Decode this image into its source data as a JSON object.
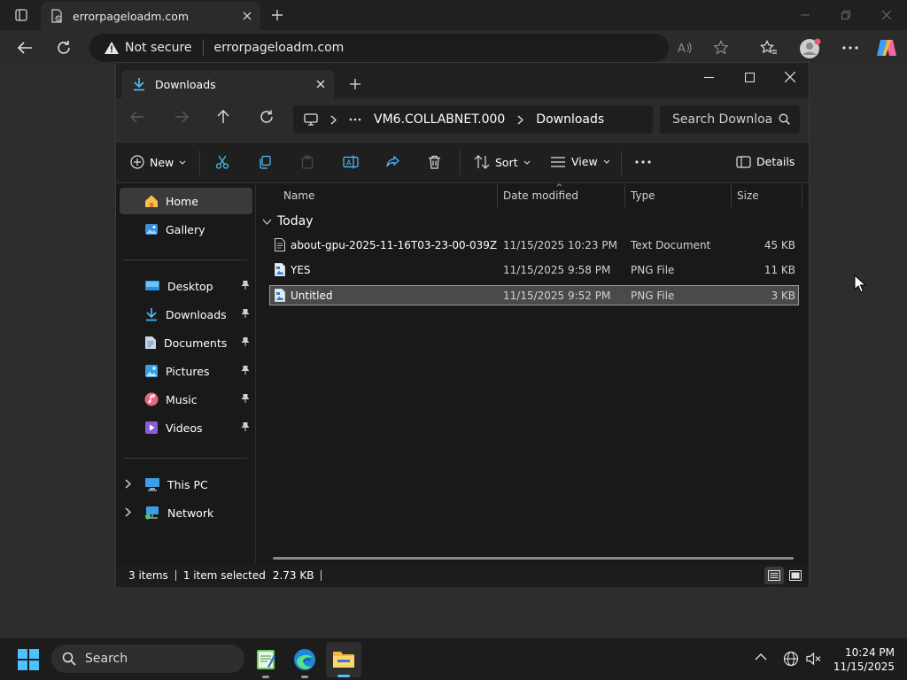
{
  "browser": {
    "tab_title": "errorpageloadm.com",
    "security_label": "Not secure",
    "url": "errorpageloadm.com"
  },
  "explorer": {
    "tab_title": "Downloads",
    "breadcrumb": [
      "VM6.COLLABNET.000",
      "Downloads"
    ],
    "search_placeholder": "Search Downloa",
    "commands": {
      "new": "New",
      "sort": "Sort",
      "view": "View",
      "details": "Details"
    },
    "sidebar": {
      "top": [
        {
          "label": "Home",
          "icon": "home-icon",
          "selected": true
        },
        {
          "label": "Gallery",
          "icon": "gallery-icon"
        }
      ],
      "pinned": [
        {
          "label": "Desktop",
          "icon": "desktop-icon"
        },
        {
          "label": "Downloads",
          "icon": "downloads-icon"
        },
        {
          "label": "Documents",
          "icon": "documents-icon"
        },
        {
          "label": "Pictures",
          "icon": "pictures-icon"
        },
        {
          "label": "Music",
          "icon": "music-icon"
        },
        {
          "label": "Videos",
          "icon": "videos-icon"
        }
      ],
      "bottom": [
        {
          "label": "This PC",
          "icon": "this-pc-icon"
        },
        {
          "label": "Network",
          "icon": "network-icon"
        }
      ]
    },
    "columns": [
      "Name",
      "Date modified",
      "Type",
      "Size"
    ],
    "group_label": "Today",
    "files": [
      {
        "name": "about-gpu-2025-11-16T03-23-00-039Z",
        "date": "11/15/2025 10:23 PM",
        "type": "Text Document",
        "size": "45 KB",
        "icon": "text-file-icon",
        "selected": false
      },
      {
        "name": "YES",
        "date": "11/15/2025 9:58 PM",
        "type": "PNG File",
        "size": "11 KB",
        "icon": "png-file-icon",
        "selected": false
      },
      {
        "name": "Untitled",
        "date": "11/15/2025 9:52 PM",
        "type": "PNG File",
        "size": "3 KB",
        "icon": "png-file-icon",
        "selected": true
      }
    ],
    "status": {
      "items": "3 items",
      "selection": "1 item selected",
      "size": "2.73 KB"
    }
  },
  "taskbar": {
    "search_label": "Search",
    "time": "10:24 PM",
    "date": "11/15/2025"
  },
  "colors": {
    "accent": "#4cc2ff",
    "folder": "#f4c04e",
    "selection": "#4a4a4a"
  }
}
